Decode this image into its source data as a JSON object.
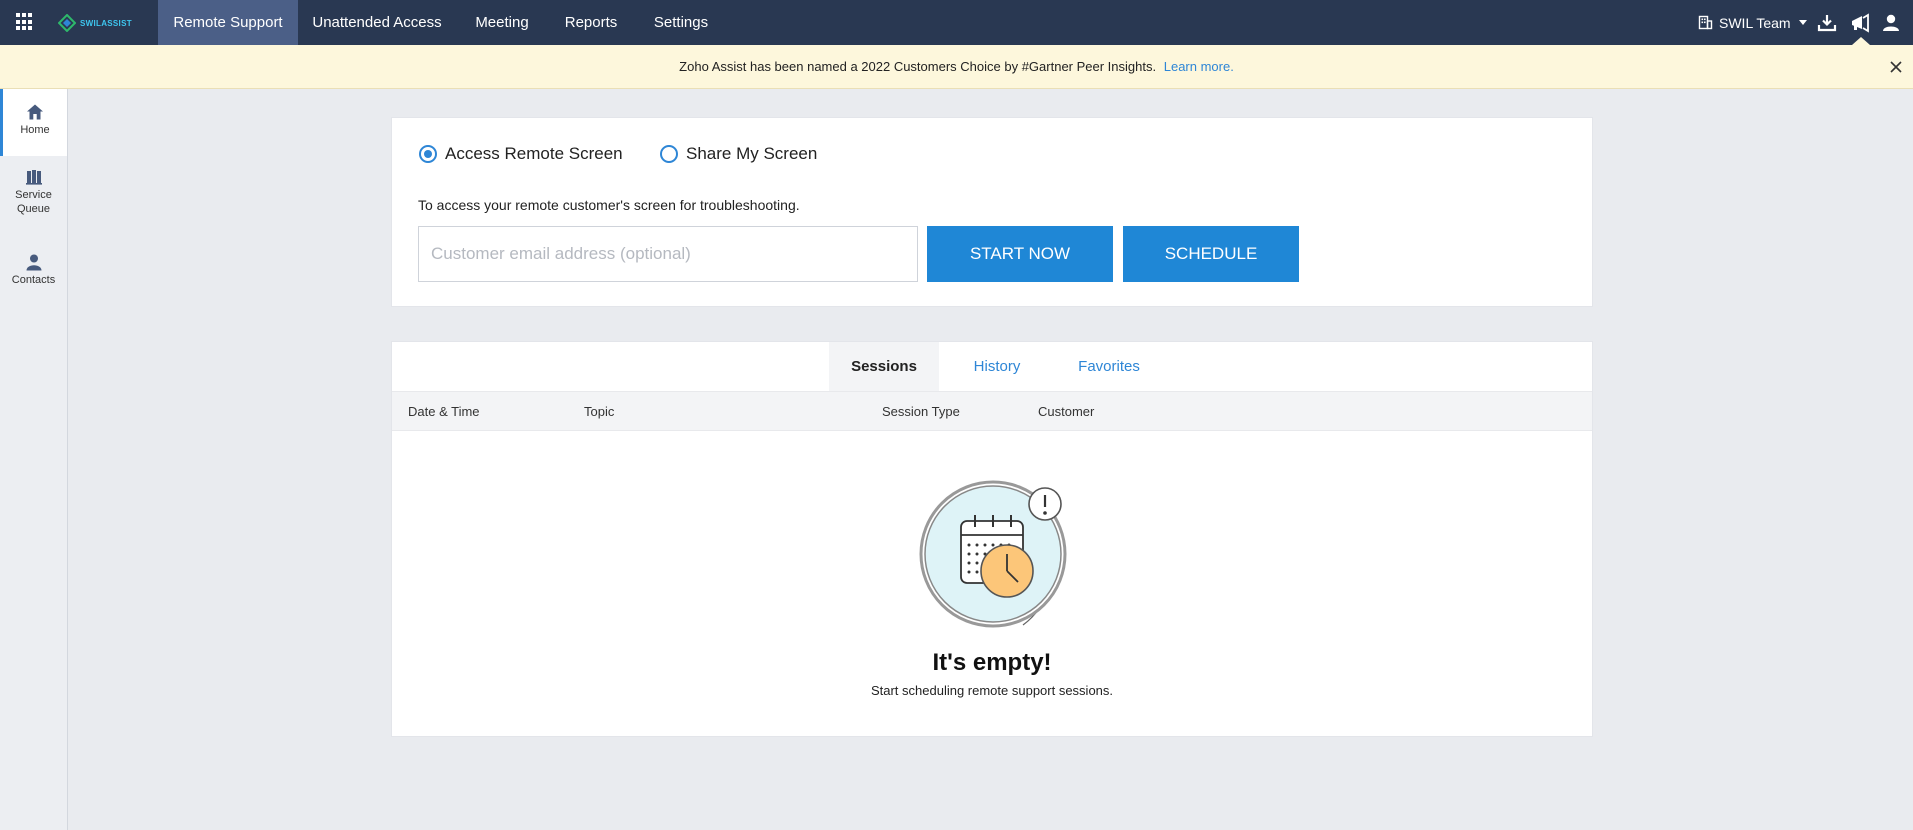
{
  "nav": {
    "tabs": [
      {
        "label": "Remote Support"
      },
      {
        "label": "Unattended Access"
      },
      {
        "label": "Meeting"
      },
      {
        "label": "Reports"
      },
      {
        "label": "Settings"
      }
    ],
    "team_label": "SWIL Team",
    "logo_text": "SWILASSIST",
    "icons": [
      "apps-grid-icon",
      "download-icon",
      "announcement-icon",
      "user-icon"
    ]
  },
  "banner": {
    "message": "Zoho Assist has been named a 2022 Customers Choice by #Gartner Peer Insights.",
    "link": "Learn more."
  },
  "sidebar": {
    "items": [
      {
        "label": "Home",
        "icon": "home-icon"
      },
      {
        "label": "Service Queue",
        "icon": "service-queue-icon"
      },
      {
        "label": "Contacts",
        "icon": "contact-icon"
      }
    ]
  },
  "start": {
    "option_access": "Access Remote Screen",
    "option_share": "Share My Screen",
    "description": "To access your remote customer's screen for troubleshooting.",
    "email_placeholder": "Customer email address (optional)",
    "start_label": "START NOW",
    "schedule_label": "SCHEDULE"
  },
  "sessions": {
    "tabs": [
      {
        "label": "Sessions"
      },
      {
        "label": "History"
      },
      {
        "label": "Favorites"
      }
    ],
    "columns": [
      "Date & Time",
      "Topic",
      "Session Type",
      "Customer"
    ],
    "empty_title": "It's empty!",
    "empty_subtitle": "Start scheduling remote support sessions."
  },
  "colors": {
    "topbar": "#293852",
    "active_tab": "#4b5f87",
    "accent": "#1f87d6",
    "banner": "#fdf7dc"
  }
}
